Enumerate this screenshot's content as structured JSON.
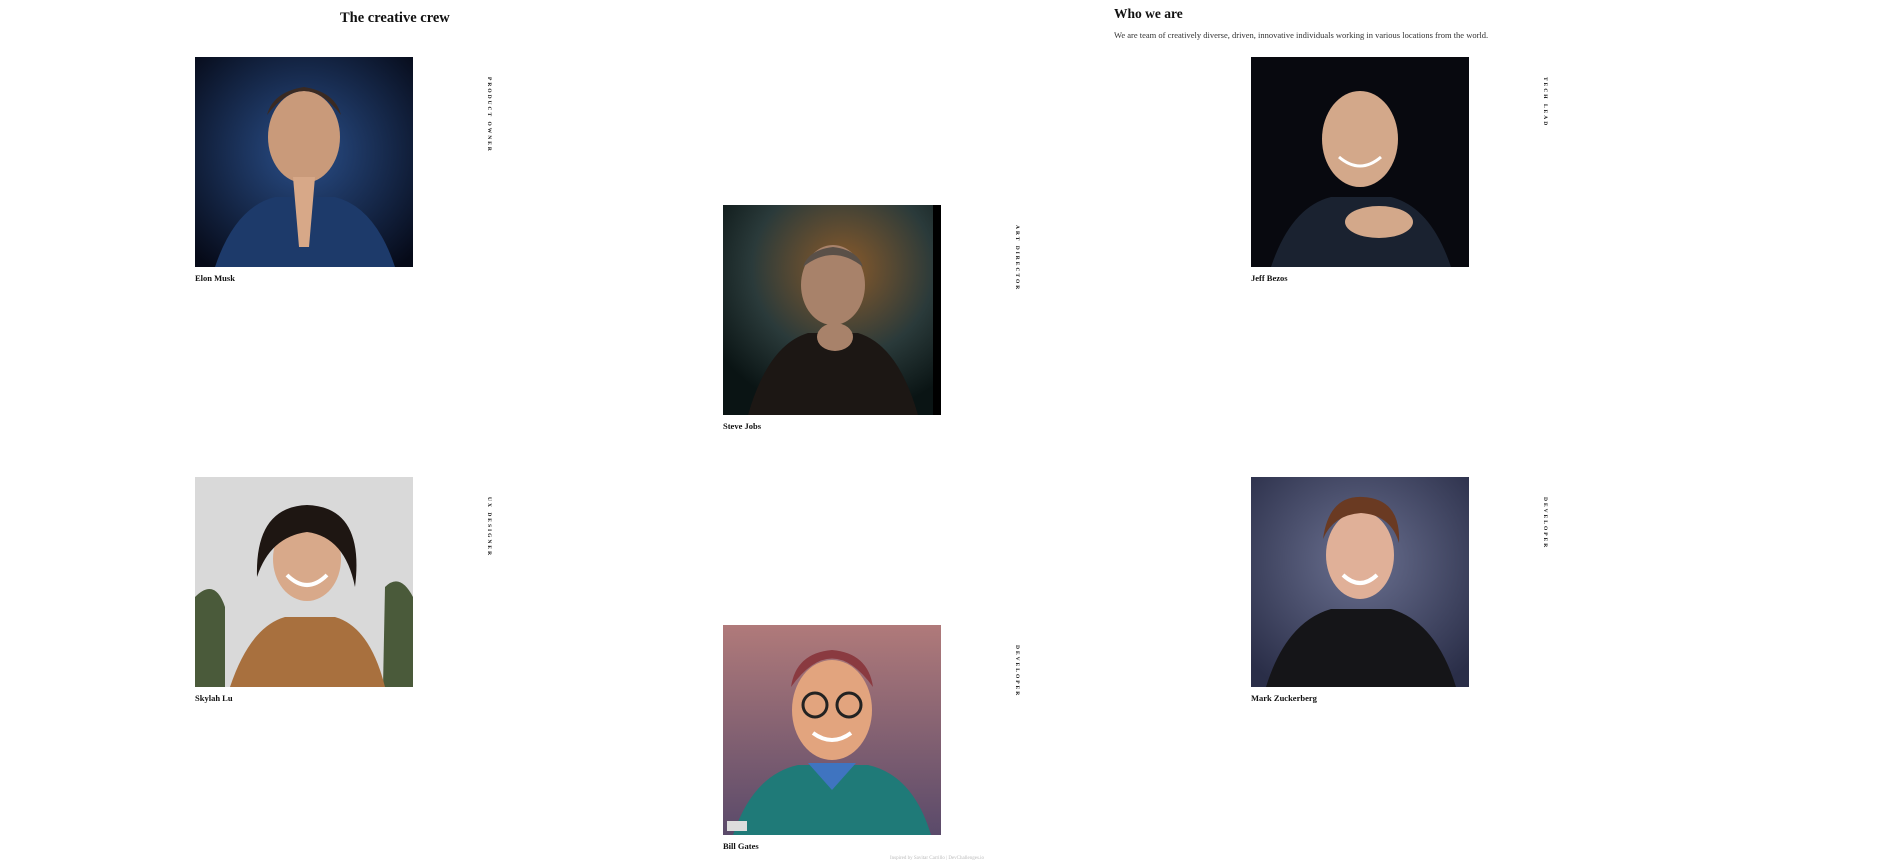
{
  "left_title": "The creative crew",
  "intro": {
    "title": "Who we are",
    "description": "We are team of creatively diverse, driven, innovative individuals working in various locations from the world."
  },
  "members": [
    {
      "name": "Elon Musk",
      "role": "PRODUCT OWNER"
    },
    {
      "name": "Steve Jobs",
      "role": "ART DIRECTOR"
    },
    {
      "name": "Jeff Bezos",
      "role": "TECH LEAD"
    },
    {
      "name": "Skylah Lu",
      "role": "UX DESIGNER"
    },
    {
      "name": "Bill Gates",
      "role": "DEVELOPER"
    },
    {
      "name": "Mark Zuckerberg",
      "role": "DEVELOPER"
    }
  ],
  "footer": "Inspired by Savitar Carrillo | DevChallenges.io",
  "colors": {
    "text": "#111111",
    "background": "#ffffff"
  }
}
